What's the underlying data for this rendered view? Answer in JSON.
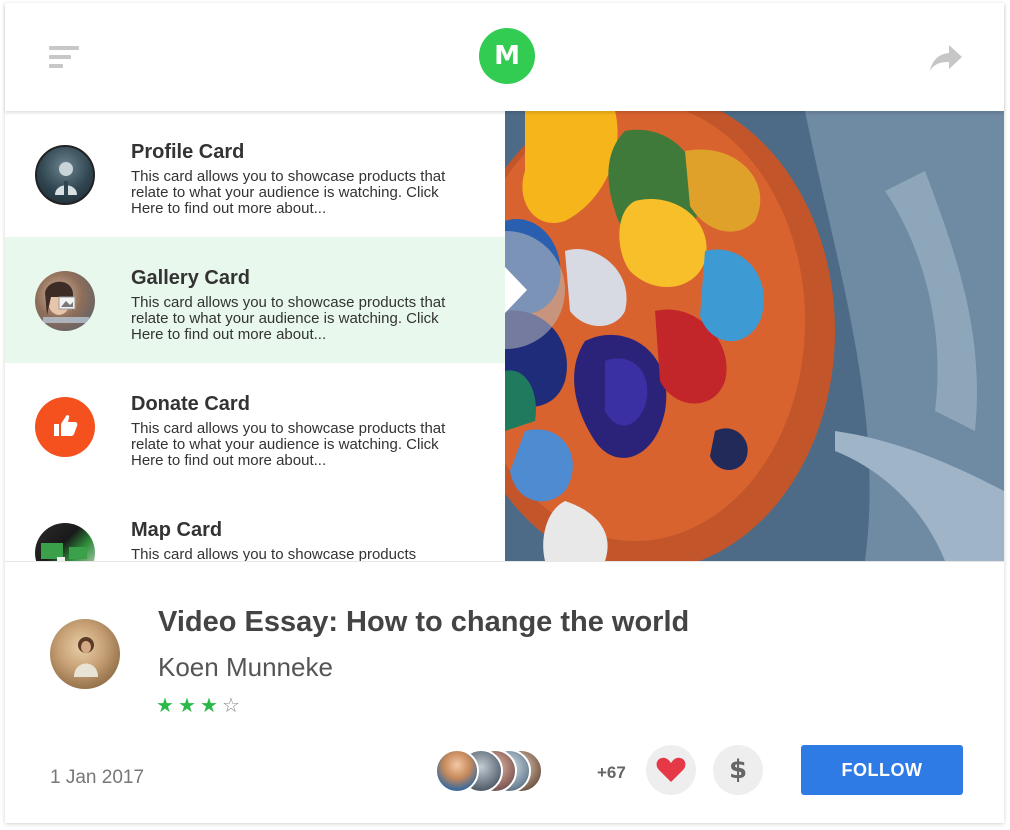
{
  "header": {
    "logo_letter": "M",
    "logo_color": "#33cc52",
    "menu_icon": "menu-icon",
    "share_icon": "share-arrow-icon"
  },
  "cards": [
    {
      "title": "Profile Card",
      "description": "This card allows you to showcase products that relate to what your audience is watching. Click Here to find out more about...",
      "icon": "profile-avatar",
      "active": false
    },
    {
      "title": "Gallery Card",
      "description": "This card allows you to showcase products that relate to what your audience is watching. Click Here to find out more about...",
      "icon": "gallery-avatar",
      "active": true
    },
    {
      "title": "Donate Card",
      "description": "This card allows you to showcase products that relate to what your audience is watching. Click Here to find out more about...",
      "icon": "thumbs-up-icon",
      "active": false
    },
    {
      "title": "Map Card",
      "description": "This card allows you to showcase products",
      "icon": "map-avatar",
      "active": false
    }
  ],
  "media": {
    "play_icon": "play-icon"
  },
  "video": {
    "title": "Video Essay: How to change the world",
    "author": "Koen Munneke",
    "rating": 3,
    "rating_max": 4,
    "date": "1 Jan 2017"
  },
  "engagement": {
    "extra_count": "+67",
    "heart_icon": "heart-icon",
    "dollar_symbol": "$",
    "follow_label": "FOLLOW"
  },
  "colors": {
    "accent_green": "#33cc52",
    "active_row": "#e8f8ec",
    "donate_orange": "#f4511e",
    "follow_blue": "#2f7be5",
    "heart_red": "#e53948",
    "star_green": "#2bb94a"
  }
}
